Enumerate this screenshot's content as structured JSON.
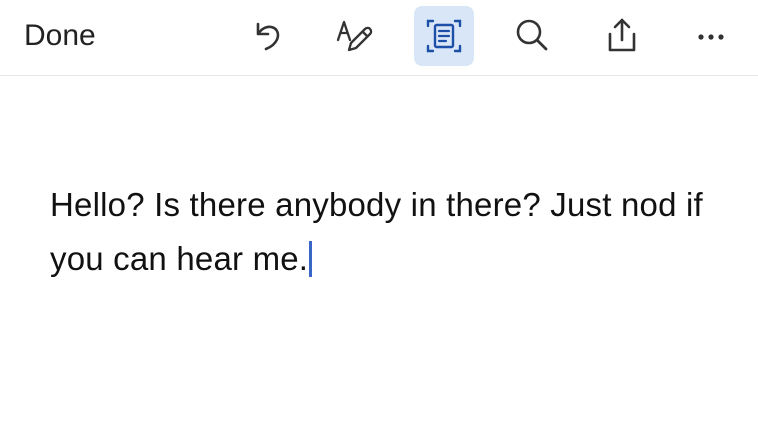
{
  "toolbar": {
    "done_label": "Done",
    "buttons": [
      {
        "icon": "undo-icon"
      },
      {
        "icon": "draw-icon"
      },
      {
        "icon": "reading-view-icon",
        "active": true
      },
      {
        "icon": "search-icon"
      },
      {
        "icon": "share-icon"
      },
      {
        "icon": "more-icon"
      }
    ]
  },
  "document": {
    "text": "Hello? Is there anybody in there? Just nod if you can hear me."
  },
  "colors": {
    "accent": "#3a66c8",
    "active_button_bg": "#d9e6f7",
    "icon_color": "#333333"
  }
}
